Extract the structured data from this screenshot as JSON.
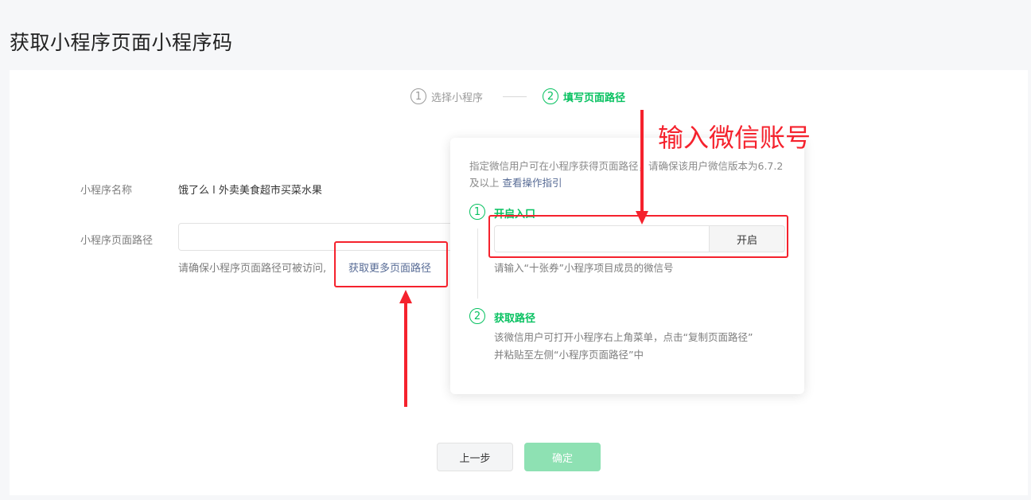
{
  "page": {
    "title": "获取小程序页面小程序码"
  },
  "steps": [
    {
      "num": "1",
      "label": "选择小程序"
    },
    {
      "num": "2",
      "label": "填写页面路径"
    }
  ],
  "form": {
    "name_label": "小程序名称",
    "name_value": "饿了么 l 外卖美食超市买菜水果",
    "path_label": "小程序页面路径",
    "path_value": "",
    "path_hint": "请确保小程序页面路径可被访问,",
    "more_link": "获取更多页面路径"
  },
  "popover": {
    "desc": "指定微信用户可在小程序获得页面路径，请确保该用户微信版本为6.7.2及以上",
    "guide_link": "查看操作指引",
    "step1": {
      "num": "1",
      "title": "开启入口",
      "input_value": "",
      "button": "开启",
      "note": "请输入“十张券”小程序项目成员的微信号"
    },
    "step2": {
      "num": "2",
      "title": "获取路径",
      "note_line1": "该微信用户可打开小程序右上角菜单，点击“复制页面路径”",
      "note_line2": "并粘贴至左侧“小程序页面路径”中"
    }
  },
  "buttons": {
    "prev": "上一步",
    "confirm": "确定"
  },
  "annotation": {
    "text": "输入微信账号",
    "color": "#f5222d"
  },
  "colors": {
    "accent": "#07c160",
    "link": "#576b95",
    "confirm_disabled": "#8ee1b3"
  }
}
